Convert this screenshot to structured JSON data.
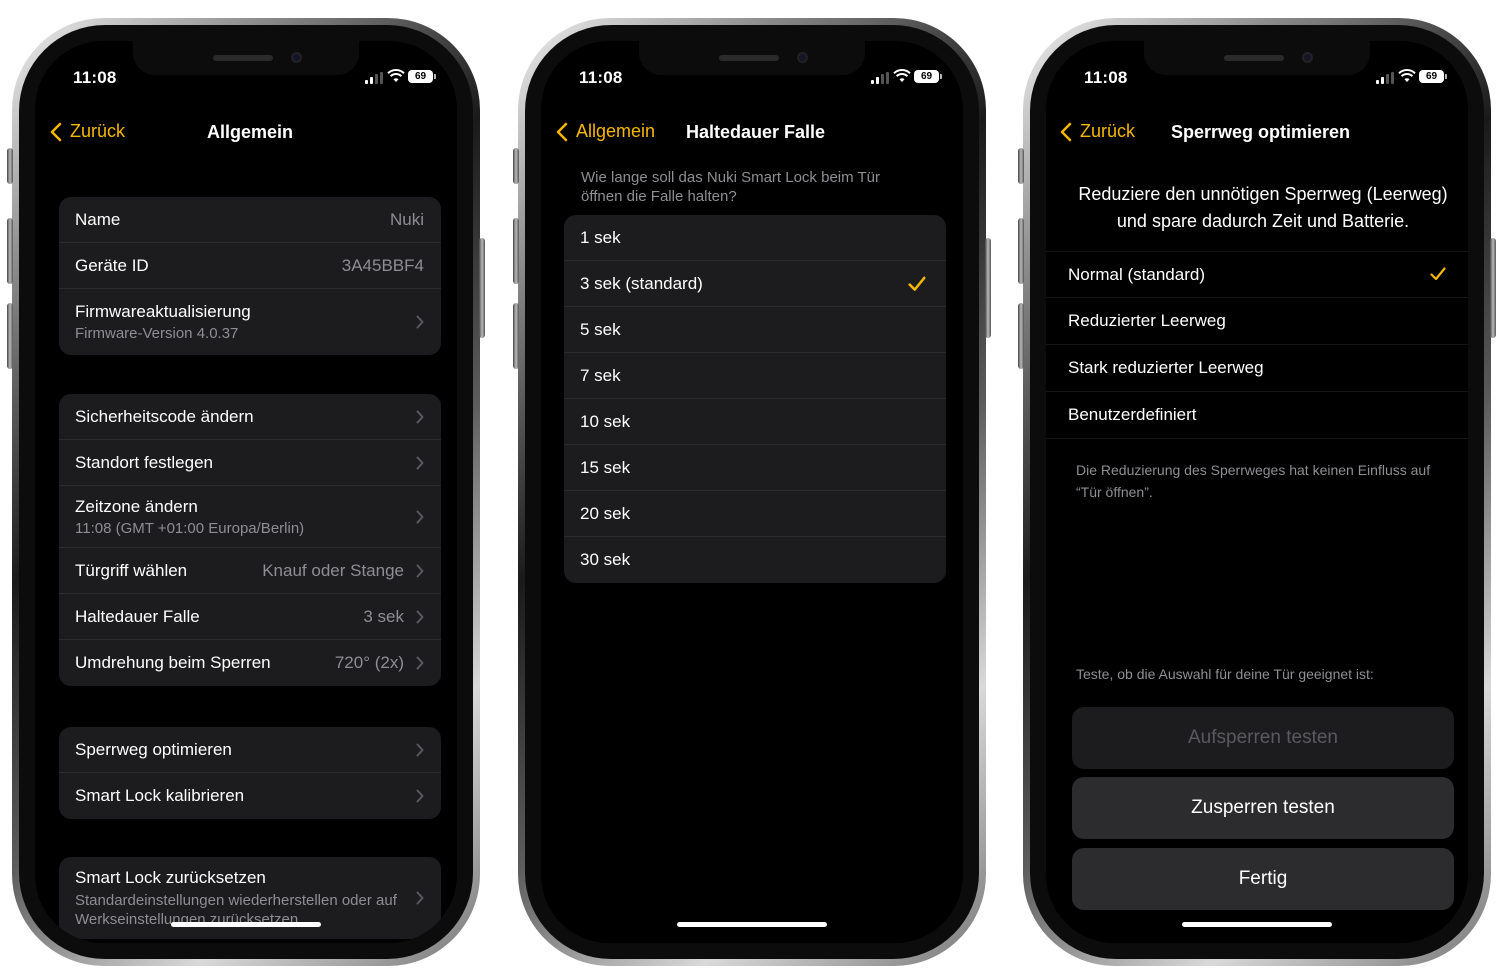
{
  "accent_color": "#f5b800",
  "status_bar": {
    "time": "11:08",
    "battery": "69"
  },
  "screens": [
    {
      "nav": {
        "back_label": "Zurück",
        "title": "Allgemein"
      },
      "groups": [
        [
          {
            "label": "Name",
            "value": "Nuki"
          },
          {
            "label": "Geräte ID",
            "value": "3A45BBF4"
          },
          {
            "label": "Firmwareaktualisierung",
            "sub": "Firmware-Version 4.0.37"
          }
        ],
        [
          {
            "label": "Sicherheitscode ändern"
          },
          {
            "label": "Standort festlegen"
          },
          {
            "label": "Zeitzone ändern",
            "sub": "11:08 (GMT +01:00 Europa/Berlin)"
          },
          {
            "label": "Türgriff wählen",
            "value": "Knauf oder Stange"
          },
          {
            "label": "Haltedauer Falle",
            "value": "3 sek"
          },
          {
            "label": "Umdrehung beim Sperren",
            "value": "720° (2x)"
          }
        ],
        [
          {
            "label": "Sperrweg optimieren"
          },
          {
            "label": "Smart Lock kalibrieren"
          }
        ],
        [
          {
            "label": "Smart Lock zurücksetzen",
            "sub": "Standardeinstellungen wiederherstellen oder auf Werkseinstellungen zurücksetzen."
          }
        ]
      ]
    },
    {
      "nav": {
        "back_label": "Allgemein",
        "title": "Haltedauer Falle"
      },
      "description": "Wie lange soll das Nuki Smart Lock beim Tür öffnen die Falle halten?",
      "options": [
        "1 sek",
        "3 sek (standard)",
        "5 sek",
        "7 sek",
        "10 sek",
        "15 sek",
        "20 sek",
        "30 sek"
      ],
      "selected": "3 sek (standard)"
    },
    {
      "nav": {
        "back_label": "Zurück",
        "title": "Sperrweg optimieren"
      },
      "intro": "Reduziere den unnötigen Sperrweg (Leerweg) und spare dadurch Zeit und Batterie.",
      "options": [
        "Normal (standard)",
        "Reduzierter Leerweg",
        "Stark reduzierter Leerweg",
        "Benutzerdefiniert"
      ],
      "selected": "Normal (standard)",
      "footnote": "Die Reduzierung des Sperrweges hat keinen Einfluss auf “Tür öffnen”.",
      "test_hint": "Teste, ob die Auswahl für deine Tür geeignet ist:",
      "buttons": {
        "unlock_test": "Aufsperren testen",
        "lock_test": "Zusperren testen",
        "done": "Fertig"
      }
    }
  ]
}
